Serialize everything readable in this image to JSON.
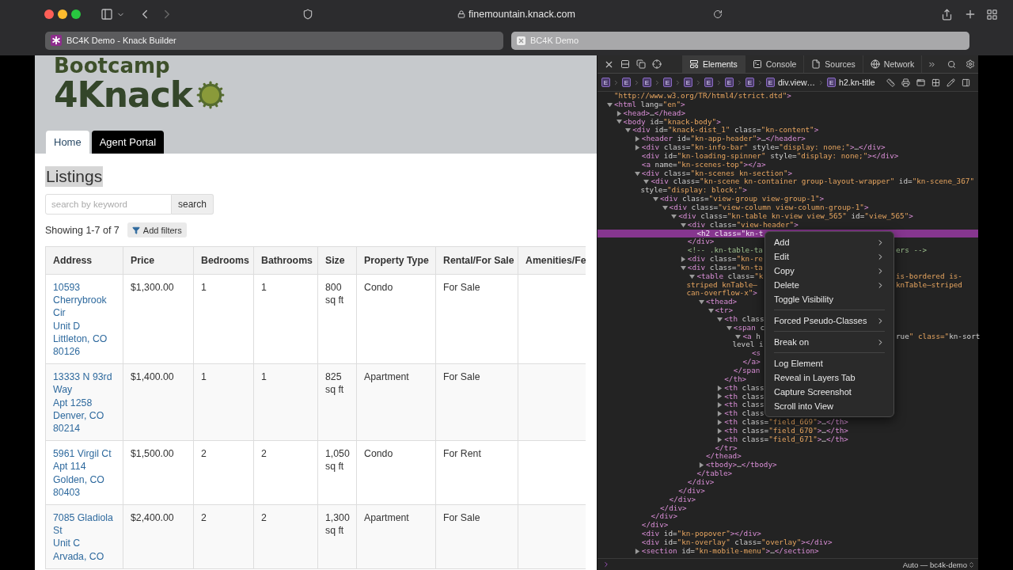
{
  "browser": {
    "url": "finemountain.knack.com",
    "tabs": [
      {
        "title": "BC4K Demo - Knack Builder",
        "selected": false
      },
      {
        "title": "BC4K Demo",
        "selected": true
      }
    ]
  },
  "page": {
    "logo": {
      "line1": "Bootcamp",
      "line2": "4Knack"
    },
    "nav": [
      {
        "label": "Home",
        "selected": true
      },
      {
        "label": "Agent Portal",
        "selected": false
      }
    ],
    "heading": "Listings",
    "search": {
      "placeholder": "search by keyword",
      "button": "search"
    },
    "summary": "Showing 1-7 of 7",
    "filter_button": "Add filters",
    "table": {
      "columns": [
        "Address",
        "Price",
        "Bedrooms",
        "Bathrooms",
        "Size",
        "Property Type",
        "Rental/For Sale",
        "Amenities/Fe"
      ],
      "rows": [
        {
          "cells": [
            [
              "10593 Cherrybrook Cir",
              "Unit D",
              "Littleton, CO 80126"
            ],
            "$1,300.00",
            "1",
            "1",
            "800 sq ft",
            "Condo",
            "For Sale",
            ""
          ]
        },
        {
          "cells": [
            [
              "13333 N 93rd Way",
              "Apt 1258",
              "Denver, CO 80214"
            ],
            "$1,400.00",
            "1",
            "1",
            "825 sq ft",
            "Apartment",
            "For Sale",
            ""
          ]
        },
        {
          "cells": [
            [
              "5961 Virgil Ct",
              "Apt 114",
              "Golden, CO 80403"
            ],
            "$1,500.00",
            "2",
            "2",
            "1,050 sq ft",
            "Condo",
            "For Rent",
            ""
          ]
        },
        {
          "cells": [
            [
              "7085 Gladiola St",
              "Unit C",
              "Arvada, CO"
            ],
            "$2,400.00",
            "2",
            "2",
            "1,300 sq ft",
            "Apartment",
            "For Sale",
            ""
          ]
        }
      ]
    }
  },
  "devtools": {
    "tabs": [
      {
        "label": "Elements",
        "selected": true
      },
      {
        "label": "Console",
        "selected": false
      },
      {
        "label": "Sources",
        "selected": false
      },
      {
        "label": "Network",
        "selected": false
      }
    ],
    "breadcrumbs": [
      {
        "badge": "E"
      },
      {
        "badge": "E"
      },
      {
        "badge": "E"
      },
      {
        "badge": "E"
      },
      {
        "badge": "E"
      },
      {
        "badge": "E"
      },
      {
        "badge": "E"
      },
      {
        "badge": "E"
      },
      {
        "badge": "E",
        "label": "div.view…"
      },
      {
        "badge": "E",
        "label": "h2.kn-title"
      }
    ],
    "dom_tree": [
      {
        "line": "\"http://www.w3.org/TR/html4/strict.dtd\">",
        "selected": false
      },
      {
        "line": "<html lang=\"en\">",
        "expanded": true,
        "selected": false,
        "children": [
          {
            "line": "<head>…</head>",
            "expanded": false,
            "selected": false
          },
          {
            "line": "<body id=\"knack-body\">",
            "expanded": true,
            "selected": false,
            "children": [
              {
                "line": "<div id=\"knack-dist_1\" class=\"kn-content\">",
                "expanded": true,
                "selected": false,
                "children": [
                  {
                    "line": "<header id=\"kn-app-header\">…</header>",
                    "expanded": false,
                    "selected": false
                  },
                  {
                    "line": "<div class=\"kn-info-bar\" style=\"display: none;\">…</div>",
                    "expanded": false,
                    "selected": false
                  },
                  {
                    "line": "<div id=\"kn-loading-spinner\" style=\"display: none;\"></div>",
                    "selected": false
                  },
                  {
                    "line": "<a name=\"kn-scenes-top\"></a>",
                    "selected": false
                  },
                  {
                    "line": "<div class=\"kn-scenes kn-section\">",
                    "expanded": true,
                    "selected": false,
                    "close": "</div>",
                    "children": [
                      {
                        "lines": [
                          "<div class=\"kn-scene kn-container group-layout-wrapper\" id=\"kn-scene_367\"",
                          "style=\"display: block;\">"
                        ],
                        "expanded": true,
                        "selected": false,
                        "close": "</div>",
                        "children": [
                          {
                            "line": "<div class=\"view-group view-group-1\">",
                            "expanded": true,
                            "selected": false,
                            "close": "</div>",
                            "children": [
                              {
                                "line": "<div class=\"view-column view-column-group-1\">",
                                "expanded": true,
                                "selected": false,
                                "close": "</div>",
                                "children": [
                                  {
                                    "line": "<div class=\"kn-table kn-view view_565\" id=\"view_565\">",
                                    "expanded": true,
                                    "selected": false,
                                    "close": "</div>",
                                    "children": [
                                      {
                                        "line": "<div class=\"view-header\">",
                                        "expanded": true,
                                        "selected": false,
                                        "close": "</div>",
                                        "children": [
                                          {
                                            "line": "<h2 class=\"kn-t",
                                            "selected": true
                                          }
                                        ]
                                      },
                                      {
                                        "line": "<!-- .kn-table-ta",
                                        "right": [
                                          "ers -->"
                                        ],
                                        "kind": "comment",
                                        "selected": false
                                      },
                                      {
                                        "line": "<div class=\"kn-re",
                                        "expanded": false,
                                        "selected": false
                                      },
                                      {
                                        "line": "<div class=\"kn-ta",
                                        "expanded": true,
                                        "selected": false,
                                        "close": "</div>",
                                        "children": [
                                          {
                                            "lines": [
                                              "<table class=\"k",
                                              "striped knTable—",
                                              "can-overflow-x\">"
                                            ],
                                            "right": [
                                              "is-bordered is-",
                                              "knTable—striped"
                                            ],
                                            "expanded": true,
                                            "selected": false,
                                            "close": "</table>",
                                            "children": [
                                              {
                                                "line": "<thead>",
                                                "expanded": true,
                                                "selected": false,
                                                "close": "</thead>",
                                                "children": [
                                                  {
                                                    "line": "<tr>",
                                                    "expanded": true,
                                                    "selected": false,
                                                    "close": "</tr>",
                                                    "children": [
                                                      {
                                                        "line": "<th class",
                                                        "expanded": true,
                                                        "selected": false,
                                                        "close": "</th>",
                                                        "children": [
                                                          {
                                                            "line": "<span c",
                                                            "expanded": true,
                                                            "selected": false,
                                                            "close": "</span",
                                                            "children": [
                                                              {
                                                                "lines": [
                                                                  "<a h",
                                                                  "level i"
                                                                ],
                                                                "right": [
                                                                  "rue\" class=\"kn-sort"
                                                                ],
                                                                "expanded": true,
                                                                "selected": false,
                                                                "close": "</a>",
                                                                "children": [
                                                                  {
                                                                    "line": "<s",
                                                                    "selected": false
                                                                  }
                                                                ]
                                                              }
                                                            ]
                                                          }
                                                        ]
                                                      },
                                                      {
                                                        "line": "<th class",
                                                        "expanded": false,
                                                        "selected": false
                                                      },
                                                      {
                                                        "line": "<th class",
                                                        "expanded": false,
                                                        "selected": false
                                                      },
                                                      {
                                                        "line": "<th class",
                                                        "expanded": false,
                                                        "selected": false
                                                      },
                                                      {
                                                        "line": "<th class",
                                                        "expanded": false,
                                                        "selected": false
                                                      },
                                                      {
                                                        "line": "<th class=\"field_669\">…</th>",
                                                        "expanded": false,
                                                        "selected": false
                                                      },
                                                      {
                                                        "line": "<th class=\"field_670\">…</th>",
                                                        "expanded": false,
                                                        "selected": false
                                                      },
                                                      {
                                                        "line": "<th class=\"field_671\">…</th>",
                                                        "expanded": false,
                                                        "selected": false
                                                      }
                                                    ]
                                                  }
                                                ]
                                              },
                                              {
                                                "line": "<tbody>…</tbody>",
                                                "expanded": false,
                                                "selected": false
                                              }
                                            ]
                                          }
                                        ]
                                      }
                                    ]
                                  }
                                ]
                              }
                            ]
                          }
                        ]
                      }
                    ]
                  },
                  {
                    "line": "<div id=\"kn-popover\"></div>",
                    "selected": false
                  },
                  {
                    "line": "<div id=\"kn-overlay\" class=\"overlay\"></div>",
                    "selected": false
                  },
                  {
                    "line": "<section id=\"kn-mobile-menu\">…</section>",
                    "expanded": false,
                    "selected": false
                  }
                ]
              }
            ]
          }
        ]
      }
    ],
    "context_menu": [
      {
        "kind": "item",
        "label": "Add",
        "submenu": true
      },
      {
        "kind": "item",
        "label": "Edit",
        "submenu": true
      },
      {
        "kind": "item",
        "label": "Copy",
        "submenu": true
      },
      {
        "kind": "item",
        "label": "Delete",
        "submenu": true
      },
      {
        "kind": "item",
        "label": "Toggle Visibility",
        "submenu": false
      },
      {
        "kind": "separator"
      },
      {
        "kind": "item",
        "label": "Forced Pseudo-Classes",
        "submenu": true
      },
      {
        "kind": "separator"
      },
      {
        "kind": "item",
        "label": "Break on",
        "submenu": true
      },
      {
        "kind": "separator"
      },
      {
        "kind": "item",
        "label": "Log Element",
        "submenu": false
      },
      {
        "kind": "item",
        "label": "Reveal in Layers Tab",
        "submenu": false
      },
      {
        "kind": "item",
        "label": "Capture Screenshot",
        "submenu": false
      },
      {
        "kind": "item",
        "label": "Scroll into View",
        "submenu": false
      }
    ],
    "console_target": "Auto — bc4k-demo"
  }
}
